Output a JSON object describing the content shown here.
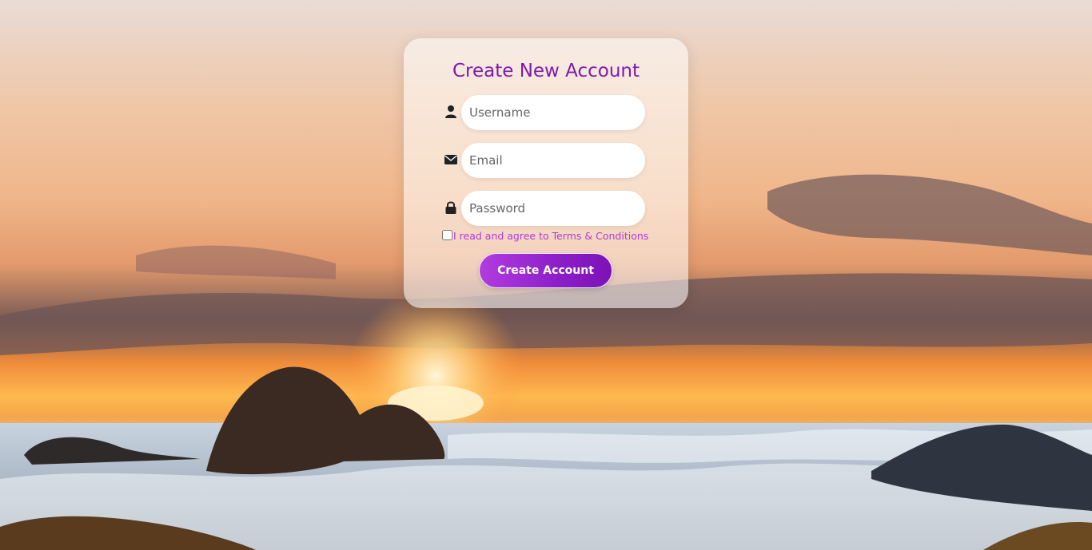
{
  "form": {
    "title": "Create New Account",
    "username": {
      "placeholder": "Username",
      "value": ""
    },
    "email": {
      "placeholder": "Email",
      "value": ""
    },
    "password": {
      "placeholder": "Password",
      "value": ""
    },
    "terms_label": "I read and agree to Terms & Conditions",
    "terms_checked": false,
    "submit_label": "Create Account"
  },
  "icons": {
    "username": "user-icon",
    "email": "envelope-icon",
    "password": "lock-icon"
  },
  "colors": {
    "title": "#7e1aa8",
    "terms_text": "#b03ad8",
    "button_start": "#b13ce0",
    "button_end": "#7c12b6",
    "button_text": "#ffffff"
  }
}
